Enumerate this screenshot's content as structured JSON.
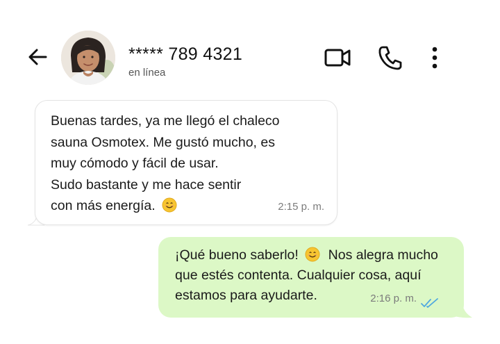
{
  "header": {
    "contact_name": "***** 789 4321",
    "status": "en línea",
    "icons": {
      "back": "back-arrow-icon",
      "avatar": "contact-avatar",
      "video": "video-camera-icon",
      "call": "phone-icon",
      "more": "more-vertical-icon"
    }
  },
  "messages": [
    {
      "direction": "incoming",
      "lines": [
        "Buenas tardes, ya me llegó el chaleco",
        "sauna Osmotex. Me gustó mucho, es",
        "muy cómodo y fácil de usar.",
        "Sudo bastante y me hace sentir",
        "con más energía."
      ],
      "emoji": "smiling-face-emoji",
      "time": "2:15 p. m."
    },
    {
      "direction": "outgoing",
      "lines": [
        "¡Qué bueno saberlo!",
        "Nos alegra mucho",
        "que estés contenta. Cualquier cosa, aquí",
        "estamos para ayudarte."
      ],
      "emoji": "smiling-face-emoji",
      "time": "2:16 p. m.",
      "status_icon": "double-check-read-icon"
    }
  ],
  "colors": {
    "outgoing_bubble": "#dcf8c6",
    "incoming_bubble": "#ffffff",
    "read_ticks": "#4fa8e0",
    "timestamp": "#7b7b7b"
  }
}
